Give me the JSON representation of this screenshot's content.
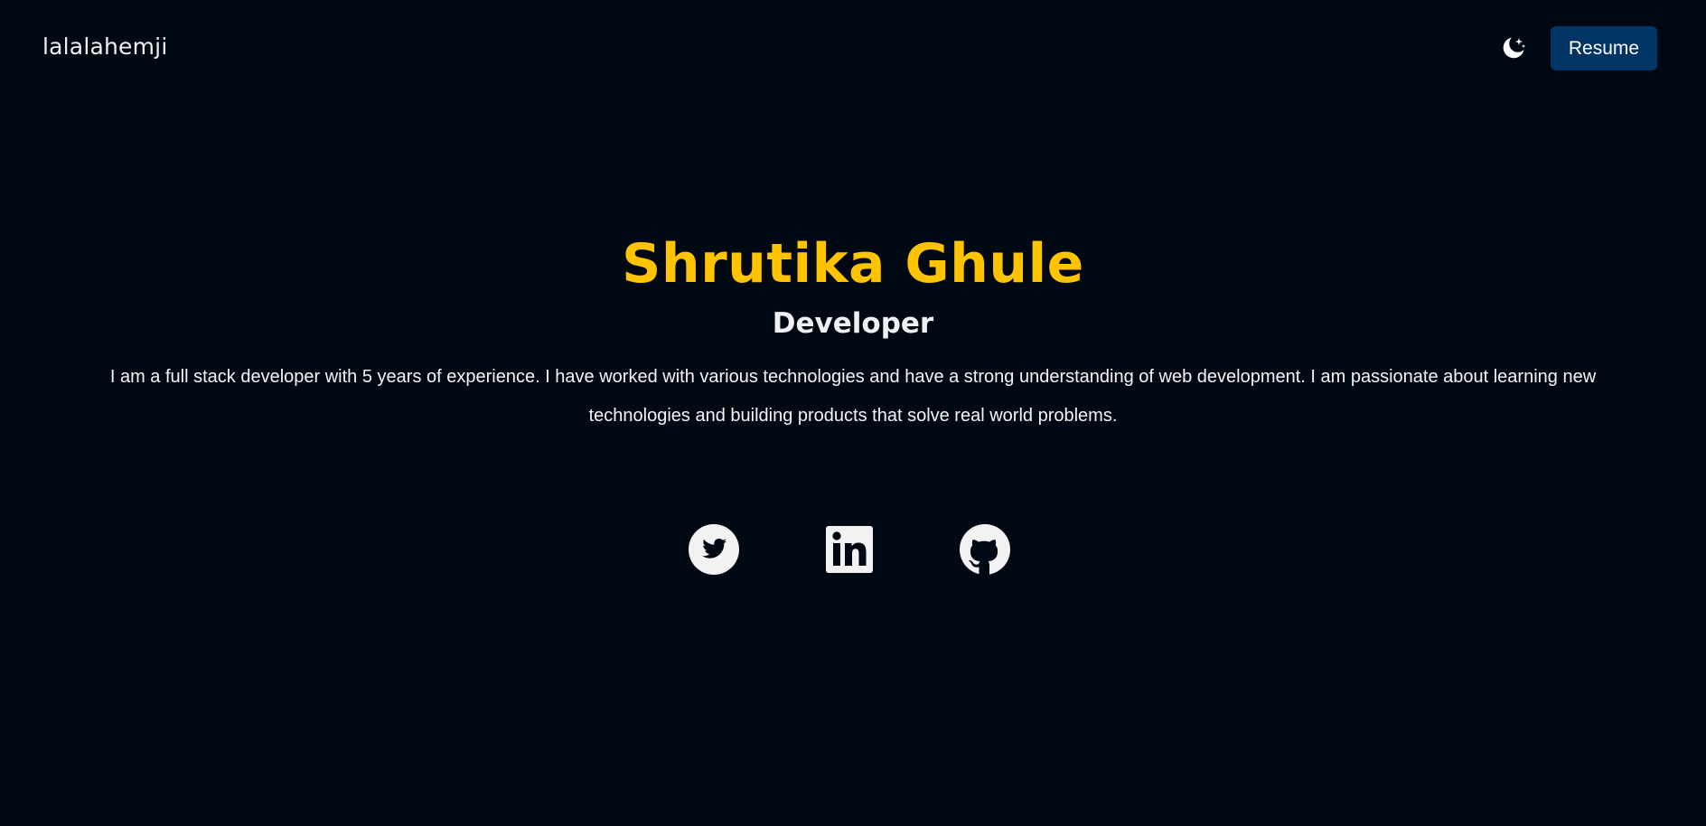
{
  "header": {
    "brand": "lalalahemji",
    "theme_toggle_icon": "moon-stars-icon",
    "resume_label": "Resume"
  },
  "hero": {
    "name": "Shrutika Ghule",
    "role": "Developer",
    "bio": "I am a full stack developer with 5 years of experience. I have worked with various technologies and have a strong understanding of web development. I am passionate about learning new technologies and building products that solve real world problems."
  },
  "socials": [
    {
      "icon": "twitter-icon"
    },
    {
      "icon": "linkedin-icon"
    },
    {
      "icon": "github-icon"
    }
  ],
  "colors": {
    "background": "#000814",
    "accent": "#ffc300",
    "button": "#003566",
    "text": "#f5f5f5"
  }
}
